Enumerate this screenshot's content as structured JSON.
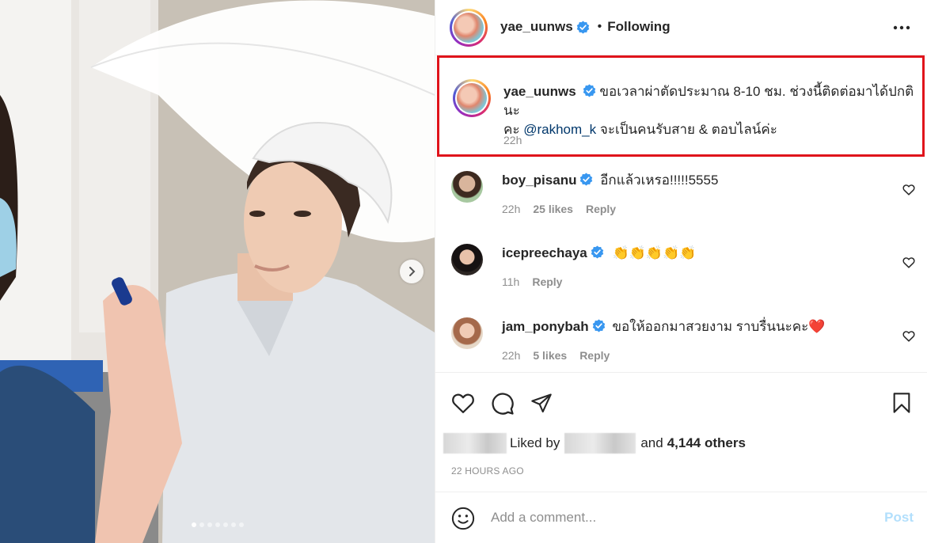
{
  "post": {
    "author": "yae_uunws",
    "follow_separator": "•",
    "follow_status": "Following",
    "caption_line1": "ขอเวลาผ่าตัดประมาณ 8-10 ชม. ช่วงนี้ติดต่อมาได้ปกตินะ",
    "caption_prefix": "คะ ",
    "caption_mention": "@rakhom_k",
    "caption_suffix": " จะเป็นคนรับสาย & ตอบไลน์ค่ะ",
    "caption_time": "22h"
  },
  "comments": [
    {
      "username": "boy_pisanu",
      "text": "อีกแล้วเหรอ!!!!!5555",
      "time": "22h",
      "likes": "25 likes",
      "reply": "Reply"
    },
    {
      "username": "icepreechaya",
      "text": "👏👏👏👏👏",
      "time": "11h",
      "likes": "",
      "reply": "Reply"
    },
    {
      "username": "jam_ponybah",
      "text": "ขอให้ออกมาสวยงาม ราบรื่นนะคะ❤️",
      "time": "22h",
      "likes": "5 likes",
      "reply": "Reply"
    }
  ],
  "likes": {
    "liked_by": "Liked by",
    "and": "and",
    "others": "4,144 others"
  },
  "timestamp": "22 HOURS AGO",
  "comment_box": {
    "placeholder": "Add a comment...",
    "post_label": "Post"
  },
  "colors": {
    "highlight_border": "#e0141b",
    "verified": "#3897f0",
    "post_disabled": "#b2dffc",
    "mention": "#00376b"
  },
  "carousel": {
    "total_slides": 7,
    "active_slide": 1
  }
}
